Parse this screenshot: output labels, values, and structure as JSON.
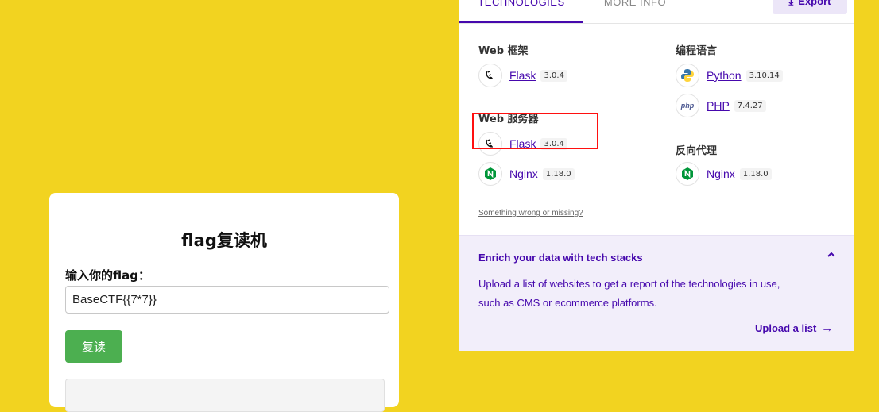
{
  "card": {
    "title": "flag复读机",
    "label": "输入你的flag：",
    "input_value": "BaseCTF{{7*7}}",
    "button_label": "复读"
  },
  "popup": {
    "tabs": [
      "TECHNOLOGIES",
      "MORE INFO"
    ],
    "export_label": "Export",
    "left_categories": [
      {
        "heading": "Web 框架",
        "items": [
          {
            "name": "Flask",
            "version": "3.0.4",
            "icon": "flask-icon"
          }
        ]
      },
      {
        "heading": "Web 服务器",
        "items": [
          {
            "name": "Flask",
            "version": "3.0.4",
            "icon": "flask-icon"
          },
          {
            "name": "Nginx",
            "version": "1.18.0",
            "icon": "nginx-icon"
          }
        ]
      }
    ],
    "right_categories": [
      {
        "heading": "编程语言",
        "items": [
          {
            "name": "Python",
            "version": "3.10.14",
            "icon": "python-icon"
          },
          {
            "name": "PHP",
            "version": "7.4.27",
            "icon": "php-icon"
          }
        ]
      },
      {
        "heading": "反向代理",
        "items": [
          {
            "name": "Nginx",
            "version": "1.18.0",
            "icon": "nginx-icon"
          }
        ]
      }
    ],
    "missing_link": "Something wrong or missing?",
    "enrich": {
      "title": "Enrich your data with tech stacks",
      "text": "Upload a list of websites to get a report of the technologies in use, such as CMS or ecommerce platforms.",
      "link": "Upload a list"
    }
  },
  "colors": {
    "page_background": "#f2d320",
    "accent": "#4608ad",
    "button_green": "#4caf50",
    "highlight": "#ff1010"
  }
}
